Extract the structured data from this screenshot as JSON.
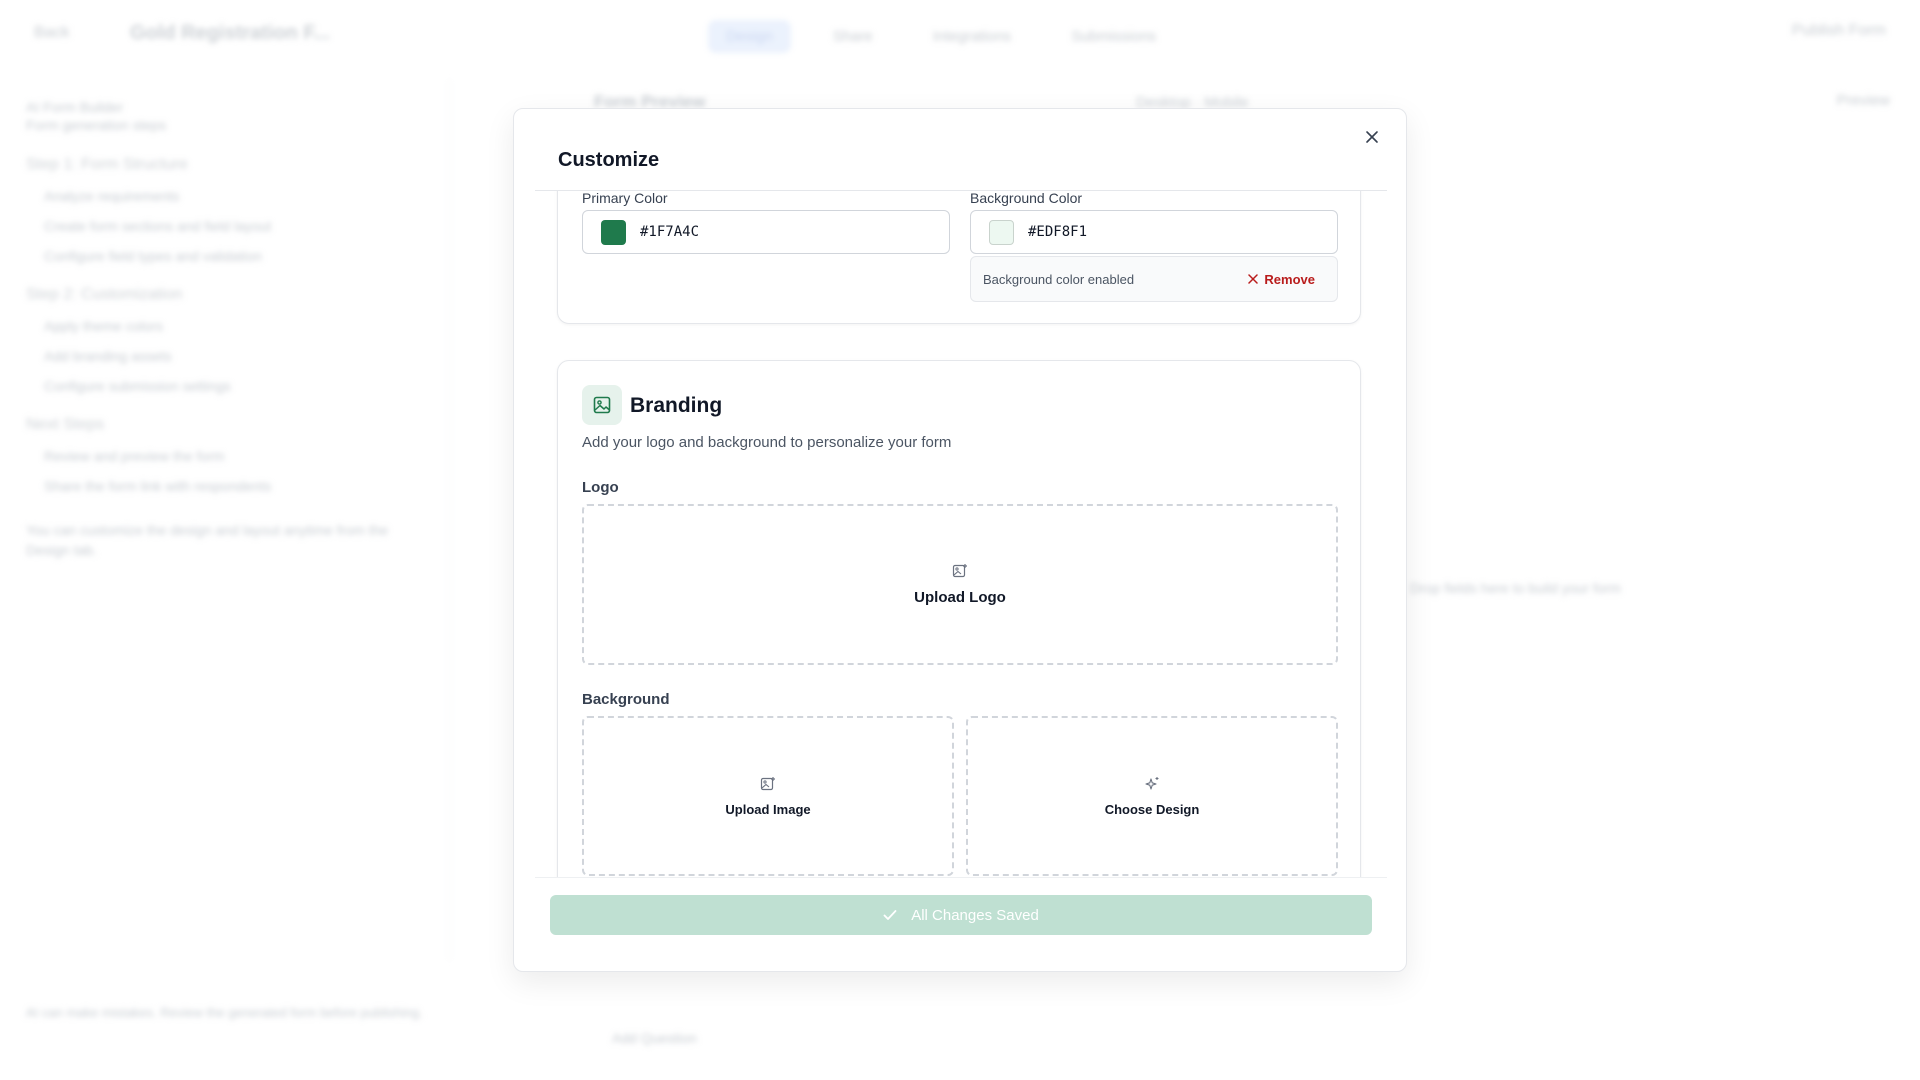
{
  "background_app": {
    "back_label": "Back",
    "form_title": "Gold Registration F...",
    "tabs": [
      "Design",
      "Share",
      "Integrations",
      "Submissions"
    ],
    "publish_label": "Publish Form",
    "sidebar": {
      "title_line1": "AI Form Builder",
      "title_line2": "Form generation steps",
      "heading1": "Step 1: Form Structure",
      "items1": [
        "Analyze requirements",
        "Create form sections and field layout",
        "Configure field types and validation"
      ],
      "heading2": "Step 2: Customization",
      "items2": [
        "Apply theme colors",
        "Add branding assets",
        "Configure submission settings"
      ],
      "heading3": "Next Steps",
      "items3": [
        "Review and preview the form",
        "Share the form link with respondents"
      ],
      "note": "You can customize the design and layout anytime from the Design tab.",
      "footer": "AI can make mistakes. Review the generated form before publishing."
    },
    "center_header": "Form Preview",
    "center_mode": "Desktop · Mobile",
    "right_tools": "Preview",
    "add_button": "Add Question",
    "empty_hint": "Drop fields here to build your form"
  },
  "modal": {
    "title": "Customize",
    "close_icon": "close-icon",
    "colors": {
      "primary_label": "Primary Color",
      "primary_hex": "#1F7A4C",
      "background_label": "Background Color",
      "background_hex": "#EDF8F1",
      "bg_enabled_text": "Background color enabled",
      "remove_label": "Remove"
    },
    "branding": {
      "icon": "image-icon",
      "title": "Branding",
      "subtitle": "Add your logo and background to personalize your form",
      "logo_label": "Logo",
      "upload_logo_label": "Upload Logo",
      "background_label": "Background",
      "upload_image_label": "Upload Image",
      "choose_design_label": "Choose Design"
    },
    "save_button_label": "All Changes Saved"
  },
  "colors": {
    "primary": "#1F7A4C",
    "background": "#EDF8F1",
    "save_disabled": "#BFE0D2",
    "danger": "#B91C1C"
  }
}
